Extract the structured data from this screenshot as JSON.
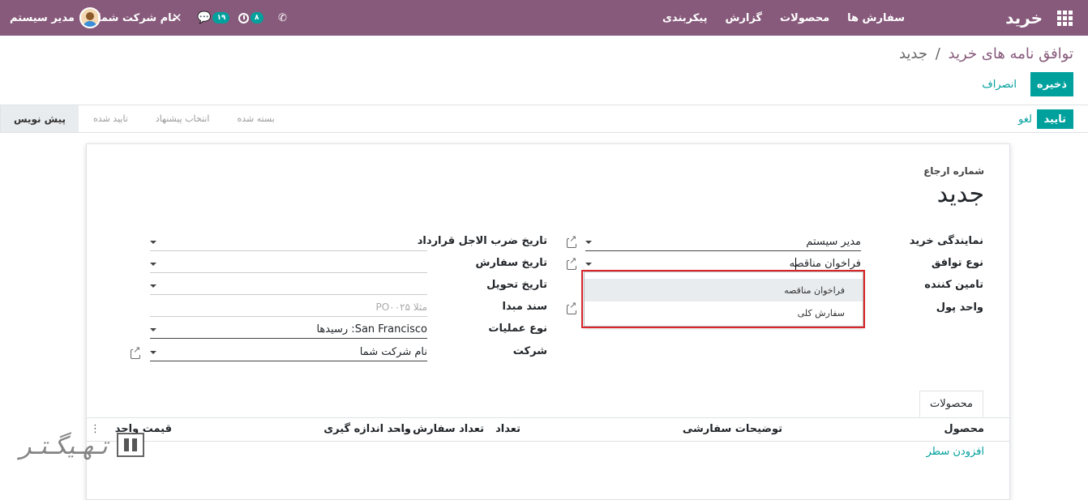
{
  "navbar": {
    "brand": "خرید",
    "menu": [
      "سفارش ها",
      "محصولات",
      "گزارش",
      "پیکربندی"
    ],
    "user_name": "مدیر سیستم",
    "company_name": "نام شرکت شما",
    "chat_count": "۱۹",
    "activity_count": "۸",
    "bg_color": "#875a7b"
  },
  "breadcrumb": {
    "parent": "توافق نامه های خرید",
    "separator": "/",
    "current": "جدید"
  },
  "actions": {
    "save": "ذخیره",
    "discard": "انصراف",
    "confirm": "تایید",
    "cancel": "لغو"
  },
  "stages": [
    {
      "label": "پیش نویس",
      "active": true
    },
    {
      "label": "تایید شده",
      "active": false
    },
    {
      "label": "انتخاب پیشنهاد",
      "active": false
    },
    {
      "label": "بسته شده",
      "active": false
    }
  ],
  "form": {
    "reference_label": "شماره ارجاع",
    "reference_value": "جدید",
    "right_fields": [
      {
        "label": "نمایندگی خرید",
        "value": "مدیر سیستم"
      },
      {
        "label": "نوع توافق",
        "value": "فراخوان مناقصه"
      },
      {
        "label": "تامین کننده",
        "value": ""
      },
      {
        "label": "واحد پول",
        "value": ""
      }
    ],
    "left_fields": [
      {
        "label": "تاریخ ضرب الاجل قرارداد",
        "value": ""
      },
      {
        "label": "تاریخ سفارش",
        "value": ""
      },
      {
        "label": "تاریخ تحویل",
        "value": ""
      },
      {
        "label": "سند مبدا",
        "value": "",
        "placeholder": "مثلا PO۰۰۲۵"
      },
      {
        "label": "نوع عملیات",
        "value": "San Francisco: رسیدها"
      },
      {
        "label": "شرکت",
        "value": "نام شرکت شما"
      }
    ]
  },
  "dropdown": {
    "options": [
      "فراخوان مناقصه",
      "سفارش کلی"
    ],
    "highlight_color": "#d9252a"
  },
  "tabs": [
    "محصولات"
  ],
  "table": {
    "headers": [
      "محصول",
      "توضیحات سفارشی",
      "تعداد",
      "تعداد سفارش ...",
      "واحد اندازه گیری",
      "قیمت واحد"
    ],
    "add_line": "افزودن سطر"
  },
  "accent_color": "#00a09d"
}
